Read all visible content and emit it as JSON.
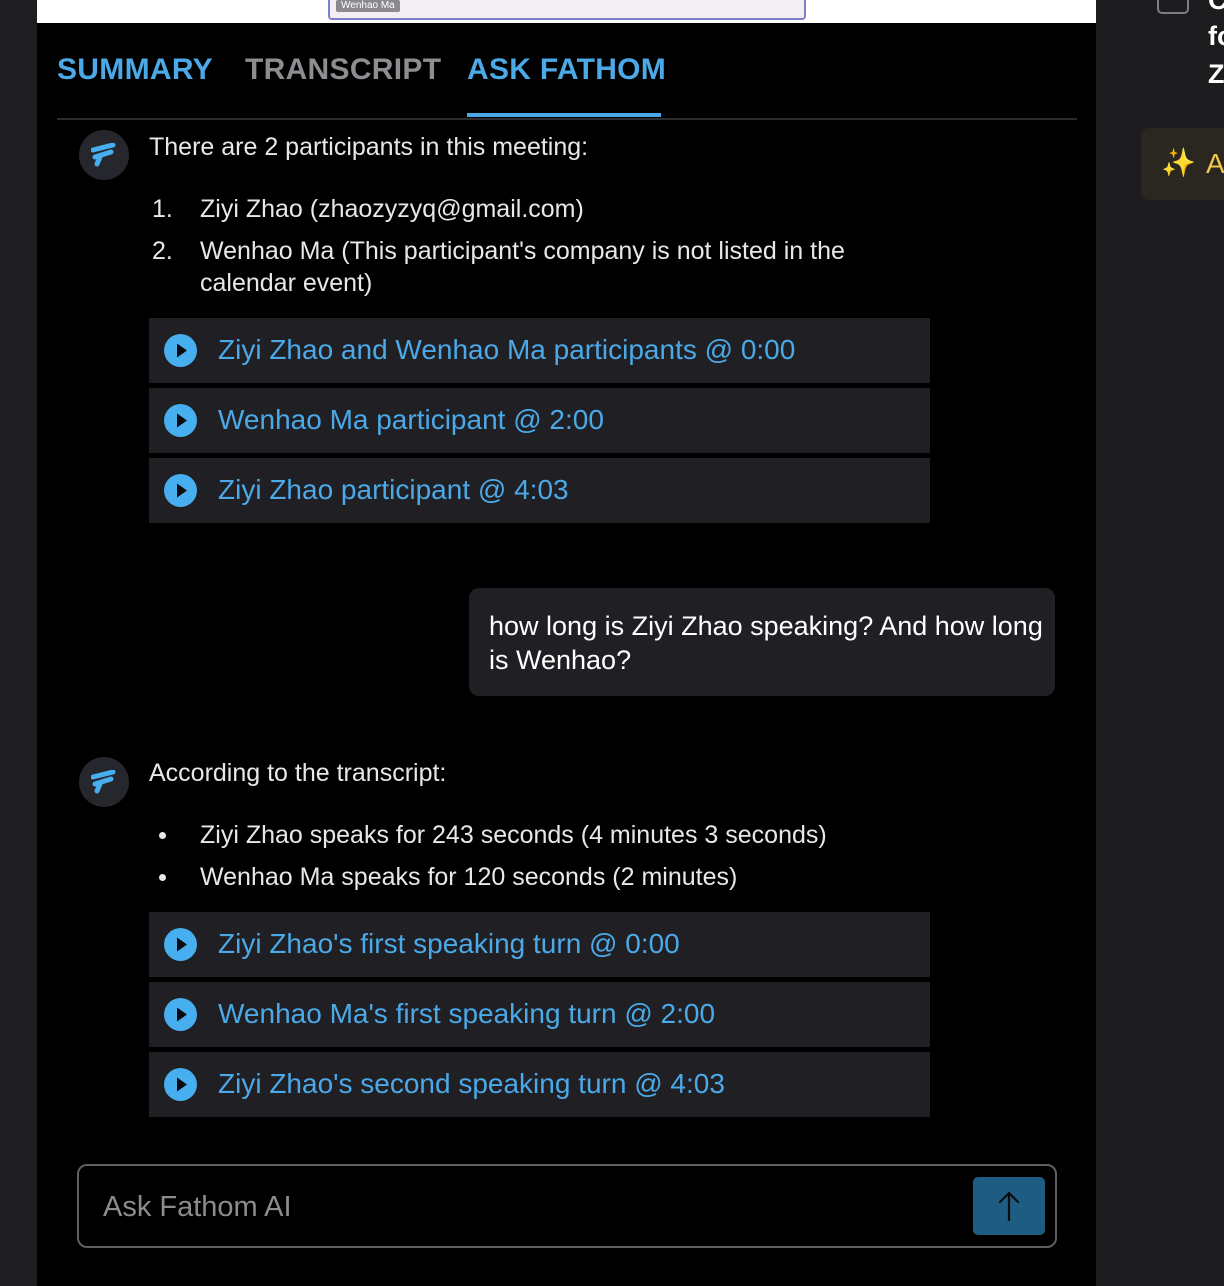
{
  "video": {
    "speaker_tag": "Wenhao Ma"
  },
  "tabs": {
    "summary": "SUMMARY",
    "transcript": "TRANSCRIPT",
    "ask": "ASK FATHOM",
    "active": "ASK FATHOM"
  },
  "conversation": {
    "answer1": {
      "intro": "There are 2 participants in this meeting:",
      "list": [
        {
          "marker": "1.",
          "text": "Ziyi Zhao (zhaozyzyq@gmail.com)"
        },
        {
          "marker": "2.",
          "text": "Wenhao Ma (This participant's company is not listed in the calendar event)"
        }
      ],
      "refs": [
        "Ziyi Zhao and Wenhao Ma participants @ 0:00",
        "Wenhao Ma participant @ 2:00",
        "Ziyi Zhao participant @ 4:03"
      ]
    },
    "user_question": "how long is Ziyi Zhao speaking? And how long is Wenhao?",
    "answer2": {
      "intro": "According to the transcript:",
      "list": [
        "Ziyi Zhao speaks for 243 seconds (4 minutes 3 seconds)",
        "Wenhao Ma speaks for 120 seconds (2 minutes)"
      ],
      "refs": [
        "Ziyi Zhao's first speaking turn @ 0:00",
        "Wenhao Ma's first speaking turn @ 2:00",
        "Ziyi Zhao's second speaking turn @ 4:03"
      ]
    }
  },
  "ask_box": {
    "placeholder": "Ask Fathom AI",
    "value": ""
  },
  "right_panel": {
    "text_lines": [
      "C",
      "fo",
      "Z"
    ],
    "ai_button_label": "A"
  },
  "icons": {
    "avatar": "fathom-logo-icon",
    "play": "play-icon",
    "send": "arrow-up-icon",
    "sparkle": "sparkle-icon"
  },
  "colors": {
    "accent": "#4ba9e8",
    "play": "#47aef0",
    "send_button": "#1f5c82",
    "card": "#1f1f24",
    "ai_button_text": "#f3c64b"
  }
}
